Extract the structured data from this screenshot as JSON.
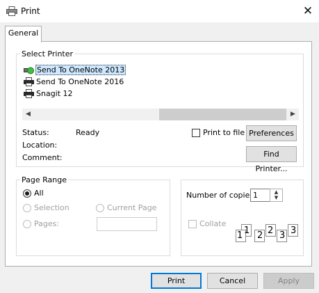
{
  "window": {
    "title": "Print",
    "close_glyph": "✕"
  },
  "tabs": [
    {
      "label": "General"
    }
  ],
  "select_printer": {
    "title": "Select Printer",
    "printers": [
      {
        "name": "Send To OneNote 2013",
        "icon": "onenote-printer-icon",
        "selected": true
      },
      {
        "name": "Send To OneNote 2016",
        "icon": "printer-icon",
        "selected": false
      },
      {
        "name": "Snagit 12",
        "icon": "printer-icon",
        "selected": false
      }
    ],
    "scroll_left": "◀",
    "scroll_right": "▶",
    "status_label": "Status:",
    "status_value": "Ready",
    "location_label": "Location:",
    "location_value": "",
    "comment_label": "Comment:",
    "comment_value": "",
    "print_to_file": "Print to file",
    "preferences": "Preferences",
    "find_printer": "Find Printer..."
  },
  "page_range": {
    "title": "Page Range",
    "all": "All",
    "selection": "Selection",
    "current_page": "Current Page",
    "pages": "Pages:",
    "pages_value": ""
  },
  "copies": {
    "label": "Number of copies:",
    "value": "1",
    "collate": "Collate",
    "collate_pages": [
      "1",
      "1",
      "2",
      "2",
      "3",
      "3"
    ]
  },
  "buttons": {
    "print": "Print",
    "cancel": "Cancel",
    "apply": "Apply"
  },
  "colors": {
    "accent": "#0078d7",
    "selection_bg": "#cde8ff",
    "window_bg": "#f0f0f0"
  }
}
